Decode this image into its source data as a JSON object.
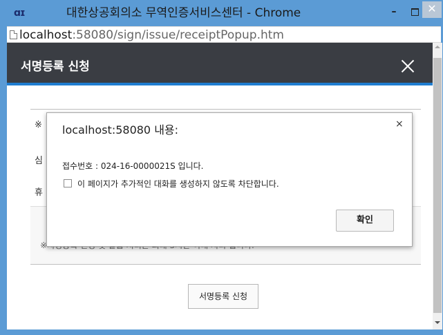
{
  "window": {
    "title": "대한상공회의소 무역인증서비스센터 - Chrome",
    "app_icon": "ɑɪ",
    "minimize_glyph": "–",
    "close_glyph": "✕"
  },
  "address": {
    "host": "localhost",
    "path": ":58080/sign/issue/receiptPopup.htm"
  },
  "popup": {
    "title": "서명등록 신청",
    "rows": [
      {
        "label": "※"
      },
      {
        "label": "심"
      },
      {
        "label": "휴"
      }
    ],
    "notice": "※서명등록 신청 및 발급 처리는 최대 3시간 이내 처리 됩니다.",
    "submit_label": "서명등록 신청"
  },
  "alert": {
    "title": "localhost:58080 내용:",
    "close_glyph": "×",
    "message": "접수번호 : 024-16-0000021S 입니다.",
    "checkbox_label": "이 페이지가 추가적인 대화를 생성하지 않도록 차단합니다.",
    "ok_label": "확인"
  },
  "colors": {
    "titlebar": "#5b9bd5",
    "popup_header": "#3a3d43",
    "header_accent": "#1f7dd0"
  }
}
